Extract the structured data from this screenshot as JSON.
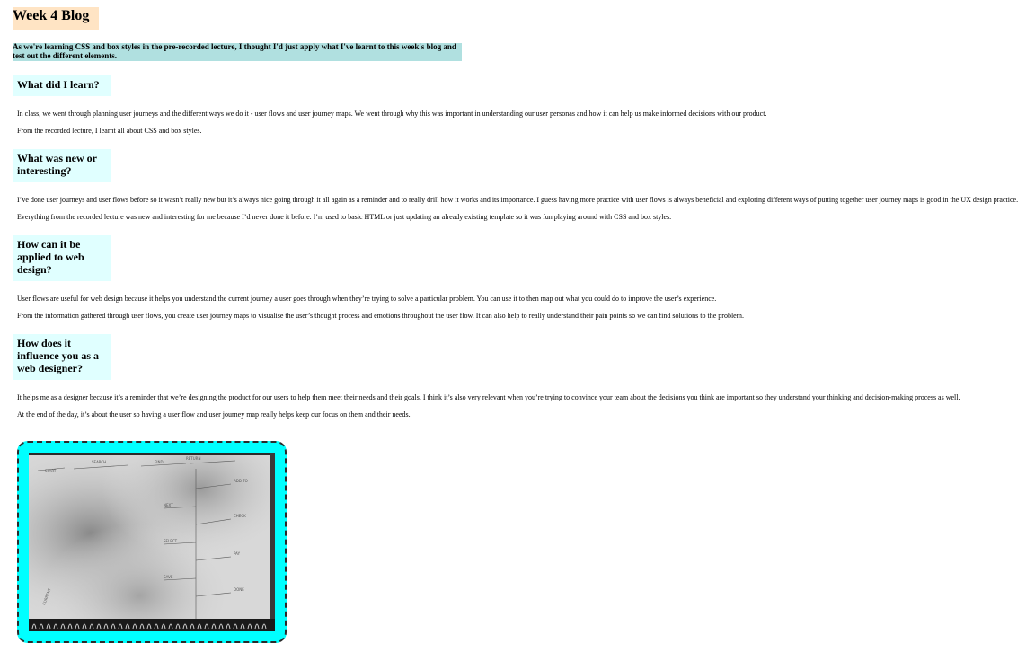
{
  "page": {
    "title": "Week 4 Blog",
    "intro": "As we're learning CSS and box styles in the pre-recorded lecture, I thought I'd just apply what I've learnt to this week's blog and test out the different elements."
  },
  "sections": [
    {
      "heading": "What did I learn?",
      "paragraphs": [
        "In class, we went through planning user journeys and the different ways we do it - user flows and user journey maps. We went through why this was important in understanding our user personas and how it can help us make informed decisions with our product.",
        "From the recorded lecture, I learnt all about CSS and box styles."
      ]
    },
    {
      "heading": "What was new or interesting?",
      "paragraphs": [
        "I’ve done user journeys and user flows before so it wasn’t really new but it’s always nice going through it all again as a reminder and to really drill how it works and its importance. I guess having more practice with user flows is always beneficial and exploring different ways of putting together user journey maps is good in the UX design practice.",
        "Everything from the recorded lecture was new and interesting for me because I’d never done it before. I’m used to basic HTML or just updating an already existing template so it was fun playing around with CSS and box styles."
      ]
    },
    {
      "heading": "How can it be applied to web design?",
      "paragraphs": [
        "User flows are useful for web design because it helps you understand the current journey a user goes through when they’re trying to solve a particular problem. You can use it to then map out what you could do to improve the user’s experience.",
        "From the information gathered through user flows, you create user journey maps to visualise the user’s thought process and emotions throughout the user flow. It can also help to really understand their pain points so we can find solutions to the problem."
      ]
    },
    {
      "heading": "How does it influence you as a web designer?",
      "paragraphs": [
        "It helps me as a designer because it’s a reminder that we’re designing the product for our users to help them meet their needs and their goals. I think it’s also very relevant when you’re trying to convince your team about the decisions you think are important so they understand your thinking and decision-making process as well.",
        "At the end of the day, it’s about the user so having a user flow and user journey map really helps keep our focus on them and their needs."
      ]
    }
  ],
  "photo": {
    "description_icon": "hand-drawn-user-flow-photo",
    "frame_color": "#00ffff"
  }
}
